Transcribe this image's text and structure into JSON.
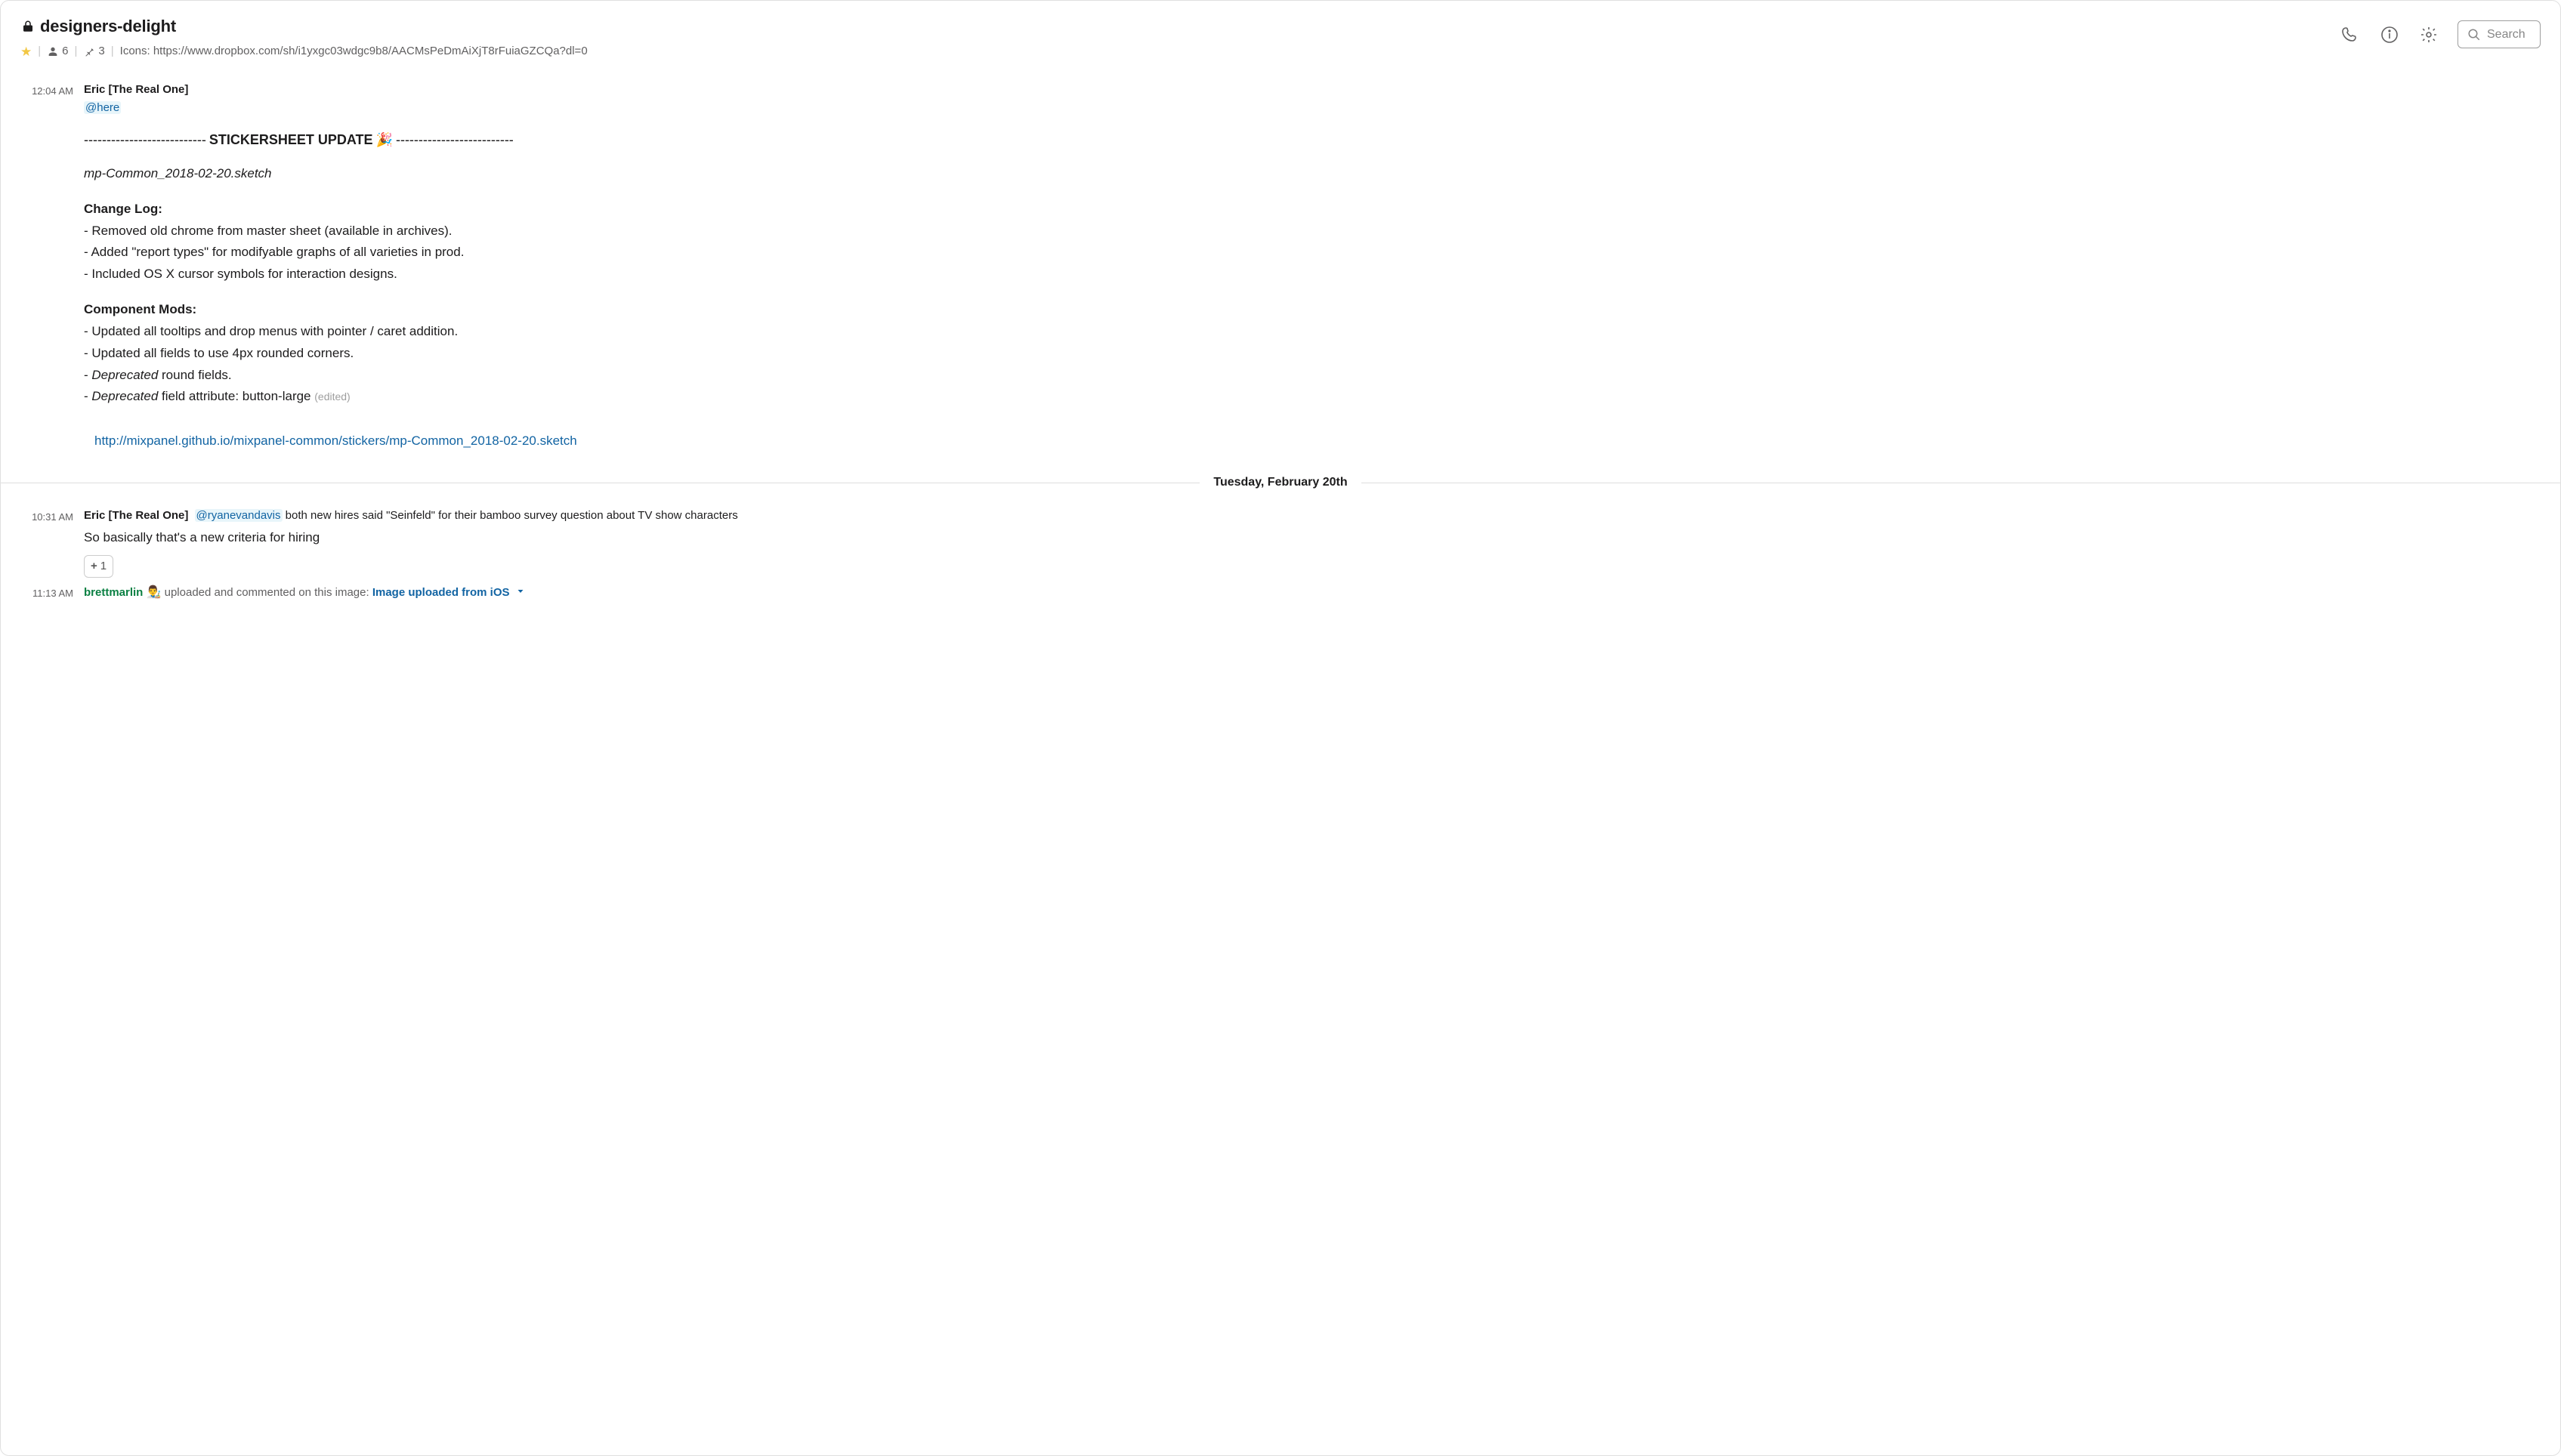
{
  "header": {
    "channel_name": "designers-delight",
    "starred": true,
    "member_count": "6",
    "pin_count": "3",
    "topic": "Icons: https://www.dropbox.com/sh/i1yxgc03wdgc9b8/AACMsPeDmAiXjT8rFuiaGZCQa?dl=0",
    "search_placeholder": "Search"
  },
  "messages": {
    "m1": {
      "time": "12:04 AM",
      "author": "Eric [The Real One]",
      "mention": "@here",
      "dash_left": "---------------------------",
      "banner": "STICKERSHEET UPDATE",
      "emoji": "🎉",
      "dash_right": "--------------------------",
      "filename": "mp-Common_2018-02-20.sketch",
      "changelog_head": "Change Log:",
      "cl1": " - Removed old chrome from master sheet (available in archives).",
      "cl2": " - Added \"report types\" for modifyable graphs of all varieties in prod.",
      "cl3": " - Included OS X cursor symbols for interaction designs.",
      "compmods_head": "Component Mods:",
      "cm1": " - Updated all tooltips and drop menus with pointer / caret addition.",
      "cm2": " - Updated all fields to use 4px rounded corners.",
      "cm3_pre": " - ",
      "cm3_dep": "Deprecated",
      "cm3_post": " round fields.",
      "cm4_pre": " - ",
      "cm4_dep": "Deprecated",
      "cm4_post": " field attribute: button-large ",
      "edited": "(edited)",
      "link": "http://mixpanel.github.io/mixpanel-common/stickers/mp-Common_2018-02-20.sketch"
    },
    "divider1": "Tuesday, February 20th",
    "m2": {
      "time": "10:31 AM",
      "author": "Eric [The Real One]",
      "mention": "@ryanevandavis",
      "rest": "  both new hires said \"Seinfeld\" for their bamboo survey question about TV show characters",
      "followup": "So basically that's a new criteria for hiring",
      "react_count": "1"
    },
    "m3": {
      "time": "11:13 AM",
      "author": "brettmarlin",
      "emoji": "👨‍🎨",
      "uptext": " uploaded and commented on this image: ",
      "filelink": "Image uploaded from iOS"
    }
  }
}
